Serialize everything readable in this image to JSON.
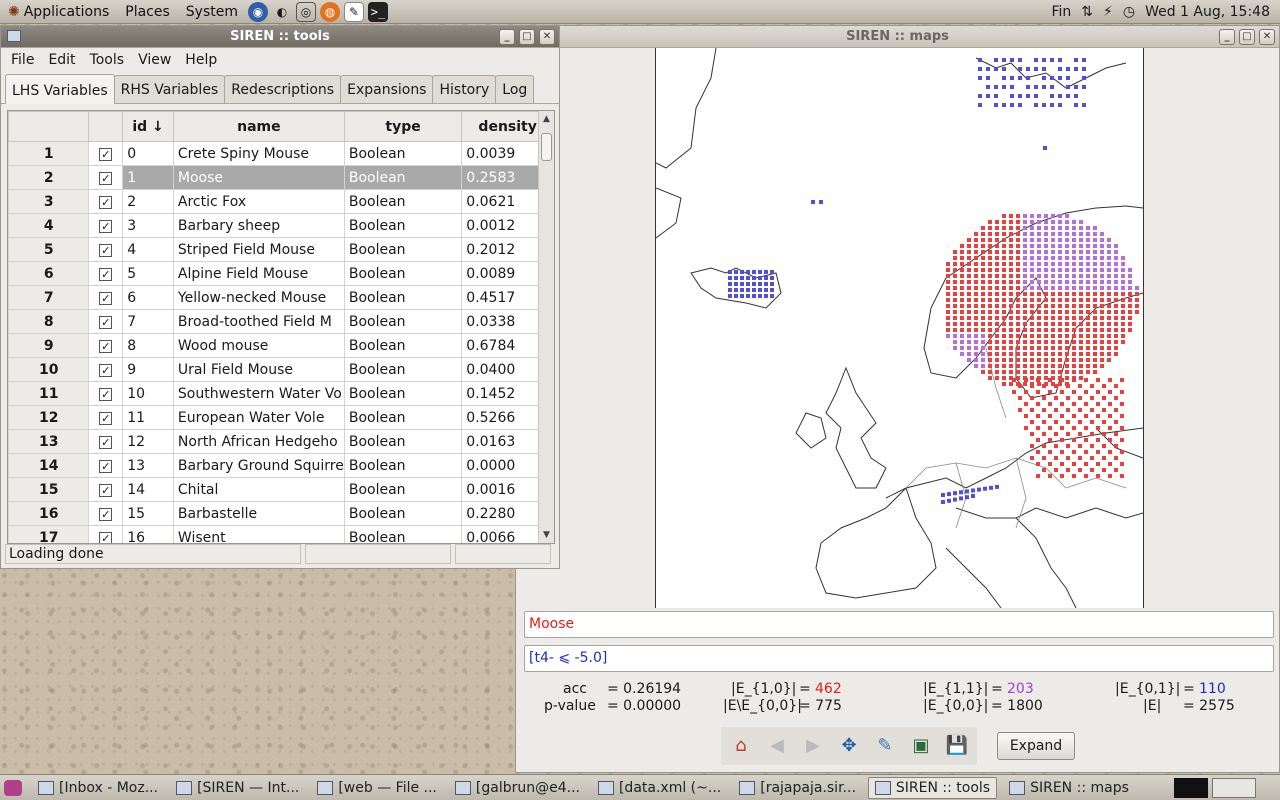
{
  "top_panel": {
    "menus": [
      "Applications",
      "Places",
      "System"
    ],
    "tray": {
      "keyboard": "Fin",
      "clock": "Wed  1 Aug, 15:48"
    }
  },
  "tools": {
    "title": "SIREN :: tools",
    "menu": [
      "File",
      "Edit",
      "Tools",
      "View",
      "Help"
    ],
    "tabs": [
      "LHS Variables",
      "RHS Variables",
      "Redescriptions",
      "Expansions",
      "History",
      "Log"
    ],
    "active_tab": "LHS Variables",
    "columns": [
      "id ↓",
      "name",
      "type",
      "density"
    ],
    "rows": [
      {
        "num": "1",
        "id": "0",
        "name": "Crete Spiny Mouse",
        "type": "Boolean",
        "density": "0.0039"
      },
      {
        "num": "2",
        "id": "1",
        "name": "Moose",
        "type": "Boolean",
        "density": "0.2583"
      },
      {
        "num": "3",
        "id": "2",
        "name": "Arctic Fox",
        "type": "Boolean",
        "density": "0.0621"
      },
      {
        "num": "4",
        "id": "3",
        "name": "Barbary sheep",
        "type": "Boolean",
        "density": "0.0012"
      },
      {
        "num": "5",
        "id": "4",
        "name": "Striped Field Mouse",
        "type": "Boolean",
        "density": "0.2012"
      },
      {
        "num": "6",
        "id": "5",
        "name": "Alpine Field Mouse",
        "type": "Boolean",
        "density": "0.0089"
      },
      {
        "num": "7",
        "id": "6",
        "name": "Yellow-necked Mouse",
        "type": "Boolean",
        "density": "0.4517"
      },
      {
        "num": "8",
        "id": "7",
        "name": "Broad-toothed Field M",
        "type": "Boolean",
        "density": "0.0338"
      },
      {
        "num": "9",
        "id": "8",
        "name": "Wood mouse",
        "type": "Boolean",
        "density": "0.6784"
      },
      {
        "num": "10",
        "id": "9",
        "name": "Ural Field Mouse",
        "type": "Boolean",
        "density": "0.0400"
      },
      {
        "num": "11",
        "id": "10",
        "name": "Southwestern Water Vo",
        "type": "Boolean",
        "density": "0.1452"
      },
      {
        "num": "12",
        "id": "11",
        "name": "European Water Vole",
        "type": "Boolean",
        "density": "0.5266"
      },
      {
        "num": "13",
        "id": "12",
        "name": "North African Hedgeho",
        "type": "Boolean",
        "density": "0.0163"
      },
      {
        "num": "14",
        "id": "13",
        "name": "Barbary Ground Squirre",
        "type": "Boolean",
        "density": "0.0000"
      },
      {
        "num": "15",
        "id": "14",
        "name": "Chital",
        "type": "Boolean",
        "density": "0.0016"
      },
      {
        "num": "16",
        "id": "15",
        "name": "Barbastelle",
        "type": "Boolean",
        "density": "0.2280"
      },
      {
        "num": "17",
        "id": "16",
        "name": "Wisent",
        "type": "Boolean",
        "density": "0.0066"
      }
    ],
    "selected_row": 1,
    "status": "Loading done"
  },
  "maps": {
    "title": "SIREN :: maps",
    "lhs_query": "Moose",
    "rhs_query": "[t4- ⩽ -5.0]",
    "stats": {
      "acc_label": "acc",
      "acc_value": "= 0.26194",
      "pvalue_label": "p-value",
      "pvalue_value": "= 0.00000",
      "e10_label": "|E_{1,0}|",
      "e10_eq": "=",
      "e10_value": "462",
      "ee00_label": "|E\\E_{0,0}|",
      "ee00_value": "= 775",
      "e11_label": "|E_{1,1}|",
      "e11_eq": "=",
      "e11_value": "203",
      "e00_label": "|E_{0,0}|",
      "e00_value": "= 1800",
      "e01_label": "|E_{0,1}|",
      "e01_eq": "=",
      "e01_value": "110",
      "e_label": "|E|",
      "e_value": "= 2575"
    },
    "colors": {
      "lhs_only": "#e8403f",
      "rhs_only": "#4f4fd8",
      "both": "#b36fe0"
    },
    "expand_label": "Expand"
  },
  "taskbar": [
    {
      "label": "[Inbox - Moz..."
    },
    {
      "label": "[SIREN — Int..."
    },
    {
      "label": "[web — File ..."
    },
    {
      "label": "[galbrun@e4..."
    },
    {
      "label": "[data.xml (~..."
    },
    {
      "label": "[rajapaja.sir..."
    },
    {
      "label": "SIREN :: tools",
      "active": true
    },
    {
      "label": "SIREN :: maps"
    }
  ]
}
